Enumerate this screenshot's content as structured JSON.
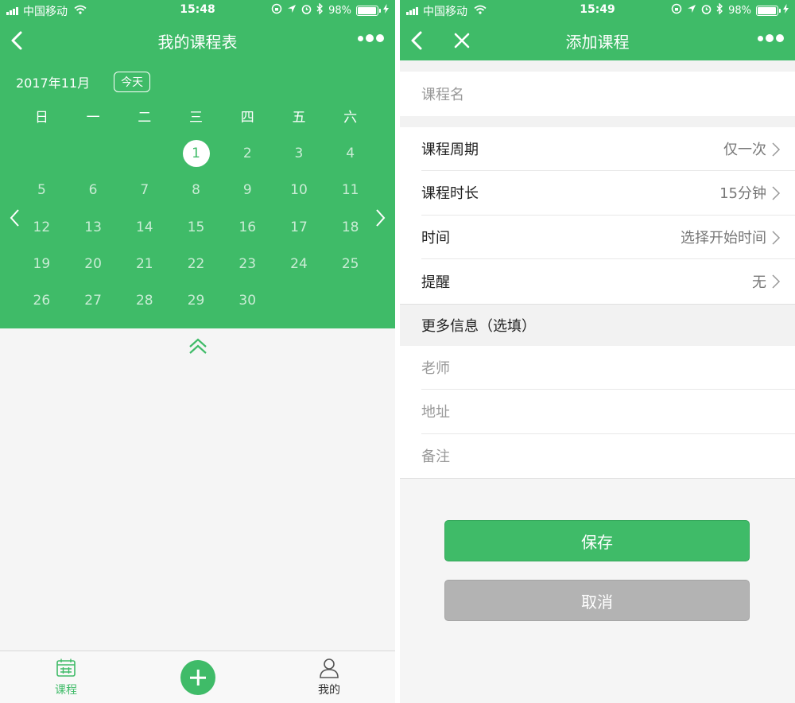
{
  "colors": {
    "accent": "#3fbb68",
    "background": "#f5f5f5",
    "cancel": "#b3b3b3"
  },
  "left": {
    "status": {
      "carrier": "中国移动",
      "time": "15:48",
      "battery": "98%"
    },
    "nav": {
      "title": "我的课程表"
    },
    "calendar": {
      "month_label": "2017年11月",
      "today_label": "今天",
      "weekdays": [
        "日",
        "一",
        "二",
        "三",
        "四",
        "五",
        "六"
      ],
      "weeks": [
        [
          "",
          "",
          "",
          "1",
          "2",
          "3",
          "4"
        ],
        [
          "5",
          "6",
          "7",
          "8",
          "9",
          "10",
          "11"
        ],
        [
          "12",
          "13",
          "14",
          "15",
          "16",
          "17",
          "18"
        ],
        [
          "19",
          "20",
          "21",
          "22",
          "23",
          "24",
          "25"
        ],
        [
          "26",
          "27",
          "28",
          "29",
          "30",
          "",
          ""
        ]
      ],
      "selected_day": "1"
    },
    "tabbar": {
      "courses_label": "课程",
      "mine_label": "我的"
    }
  },
  "right": {
    "status": {
      "carrier": "中国移动",
      "time": "15:49",
      "battery": "98%"
    },
    "nav": {
      "title": "添加课程"
    },
    "course_name_placeholder": "课程名",
    "settings": [
      {
        "label": "课程周期",
        "value": "仅一次"
      },
      {
        "label": "课程时长",
        "value": "15分钟"
      },
      {
        "label": "时间",
        "value": "选择开始时间"
      },
      {
        "label": "提醒",
        "value": "无"
      }
    ],
    "more_info_title": "更多信息（选填）",
    "more_fields": [
      "老师",
      "地址",
      "备注"
    ],
    "save_label": "保存",
    "cancel_label": "取消"
  }
}
